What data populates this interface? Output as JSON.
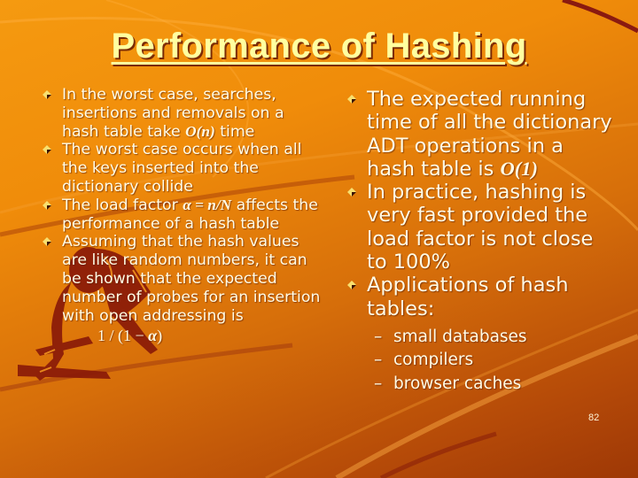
{
  "slide": {
    "title": "Performance of Hashing",
    "page_number": "82",
    "colors": {
      "title": "#ffffa0",
      "text": "#fffbe6",
      "background_top": "#f59a10",
      "background_bottom": "#9e3806",
      "accent_dark": "#8a1a08"
    },
    "left_column": {
      "bullets": [
        {
          "pre": "In the worst case, searches, insertions and removals on a hash table take ",
          "math": "O(n)",
          "post": " time"
        },
        {
          "pre": "The worst case occurs when all the keys inserted into the dictionary collide",
          "math": "",
          "post": ""
        },
        {
          "pre": "The load factor ",
          "math": "α = n/N",
          "post": " affects the performance of a hash table"
        },
        {
          "pre": "Assuming that the hash values are like random numbers, it can be shown that the expected number of probes for an insertion with open addressing is",
          "math": "",
          "post": ""
        }
      ],
      "formula": {
        "pre": "1 / (1 − ",
        "math": "α",
        "post": ")"
      }
    },
    "right_column": {
      "bullets": [
        {
          "pre": "The expected running time of all the dictionary ADT operations in a hash table is ",
          "math": "O(1)",
          "post": ""
        },
        {
          "pre": "In practice, hashing is very fast provided the load factor is not close to 100%",
          "math": "",
          "post": ""
        },
        {
          "pre": "Applications of hash tables:",
          "math": "",
          "post": ""
        }
      ],
      "sub_items": [
        {
          "dash": "–",
          "label": "small databases"
        },
        {
          "dash": "–",
          "label": "compilers"
        },
        {
          "dash": "–",
          "label": "browser caches"
        }
      ]
    },
    "icons": {
      "bullet": "diamond-bullet-icon",
      "background_art": "runner-silhouette"
    }
  }
}
